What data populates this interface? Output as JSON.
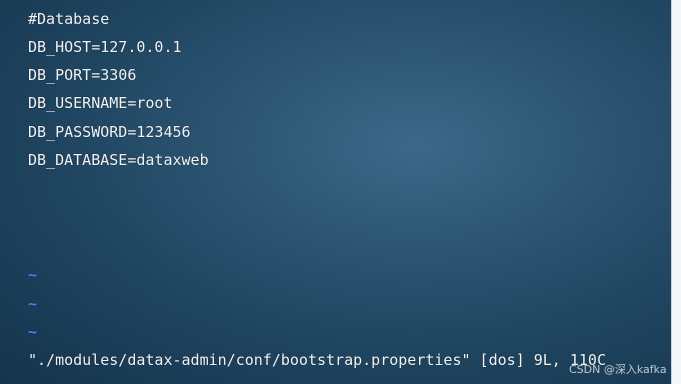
{
  "editor": {
    "lines": [
      "#Database",
      "DB_HOST=127.0.0.1",
      "DB_PORT=3306",
      "DB_USERNAME=root",
      "DB_PASSWORD=123456",
      "DB_DATABASE=dataxweb"
    ],
    "empty_line_marker": "~",
    "status_line": "\"./modules/datax-admin/conf/bootstrap.properties\" [dos] 9L, 110C"
  },
  "watermark": "CSDN @深入kafka",
  "colors": {
    "background": "#2d5674",
    "text": "#f2f4f6",
    "tilde": "#5b7cff"
  }
}
